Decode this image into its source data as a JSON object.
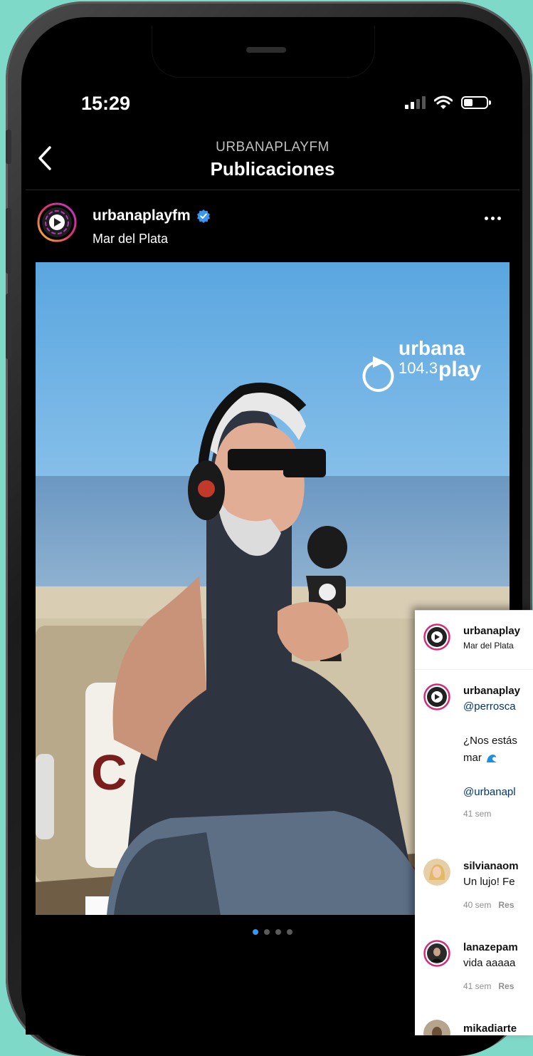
{
  "status": {
    "time": "15:29"
  },
  "header": {
    "subtitle": "URBANAPLAYFM",
    "title": "Publicaciones"
  },
  "post": {
    "username": "urbanaplayfm",
    "verified": true,
    "location": "Mar del Plata",
    "image_logo": {
      "name": "urbana",
      "freq": "104.3",
      "word": "play"
    },
    "carousel": {
      "total": 4,
      "active": 1
    }
  },
  "comments_panel": {
    "header": {
      "username": "urbanaplay",
      "location": "Mar del Plata"
    },
    "caption": {
      "username": "urbanaplay",
      "mention": "@perrosca",
      "line1": "¿Nos estás",
      "line2": "mar",
      "link": "@urbanapl",
      "time": "41 sem"
    },
    "items": [
      {
        "username": "silvianaom",
        "text": "Un lujo! Fe",
        "time": "40 sem",
        "reply": "Res"
      },
      {
        "username": "lanazepam",
        "text": "vida aaaaa",
        "time": "41 sem",
        "reply": "Res"
      },
      {
        "username": "mikadiarte"
      }
    ]
  },
  "colors": {
    "background": "#7fd9c9",
    "verified": "#3897f0",
    "link": "#00376b"
  }
}
